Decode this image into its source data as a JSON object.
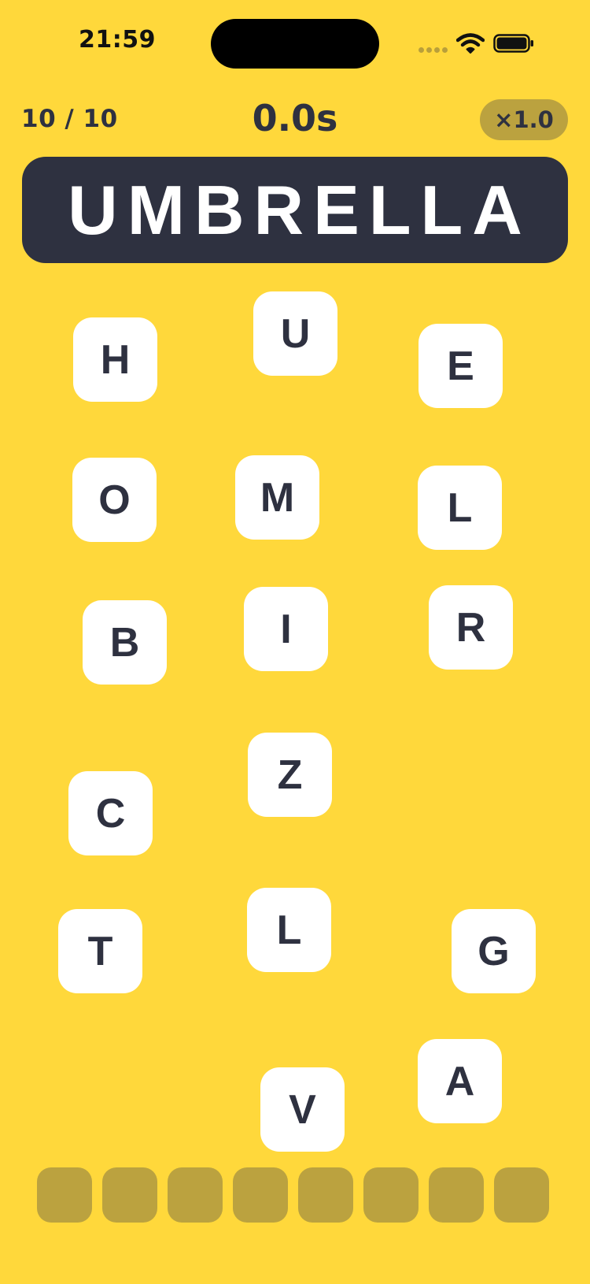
{
  "status_bar": {
    "time": "21:59",
    "icons": [
      "signal-dots-icon",
      "wifi-icon",
      "battery-icon"
    ]
  },
  "header": {
    "progress": "10 / 10",
    "timer": "0.0s",
    "multiplier": "×1.0"
  },
  "target_word": "UMBRELLA",
  "tiles": [
    "H",
    "U",
    "E",
    "O",
    "M",
    "L",
    "B",
    "I",
    "R",
    "Z",
    "C",
    "T",
    "L",
    "G",
    "A",
    "V"
  ],
  "answer_slots": {
    "count": 8,
    "filled": []
  },
  "colors": {
    "background": "#FFD83B",
    "banner": "#2E3140",
    "tile": "#FFFFFF",
    "slot": "#BBA23F",
    "text_dark": "#2E3140"
  }
}
